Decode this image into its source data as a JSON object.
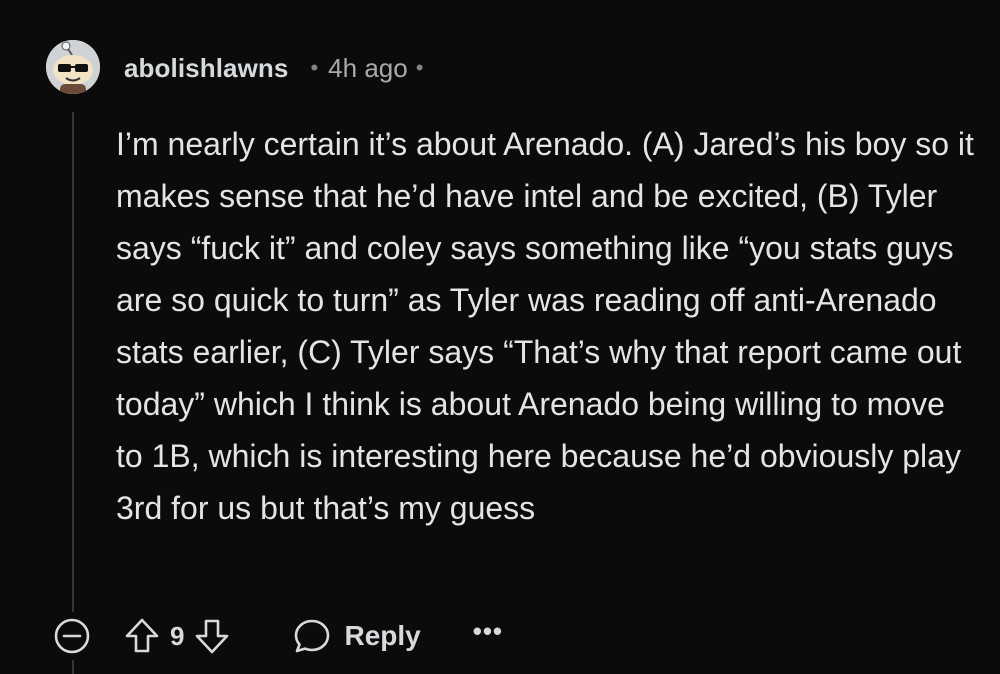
{
  "comment": {
    "username": "abolishlawns",
    "separator": "•",
    "timestamp": "4h ago",
    "trailing_separator": "•",
    "body": [
      "I’m nearly certain it’s about Arenado. (A) Jared’s his boy so it makes sense that he’d have intel and be excited, (B) Tyler says “fuck it” and coley says something like “you stats guys are so quick to turn” as Tyler was reading off anti-Arenado stats earlier, (C) Tyler says “That’s why that report came out today” which I think is about Arenado being willing to move to 1B, which is interesting here because he’d obviously play 3rd for us but that’s my guess"
    ]
  },
  "actions": {
    "collapse_icon": "collapse-minus-icon",
    "upvote_icon": "upvote-arrow-icon",
    "vote_count": "9",
    "downvote_icon": "downvote-arrow-icon",
    "reply_icon": "speech-bubble-icon",
    "reply_label": "Reply",
    "more_label": "•••"
  },
  "colors": {
    "background": "#0b0b0b",
    "text": "#d7dadc",
    "muted": "#818384",
    "thread_line": "#343536"
  }
}
